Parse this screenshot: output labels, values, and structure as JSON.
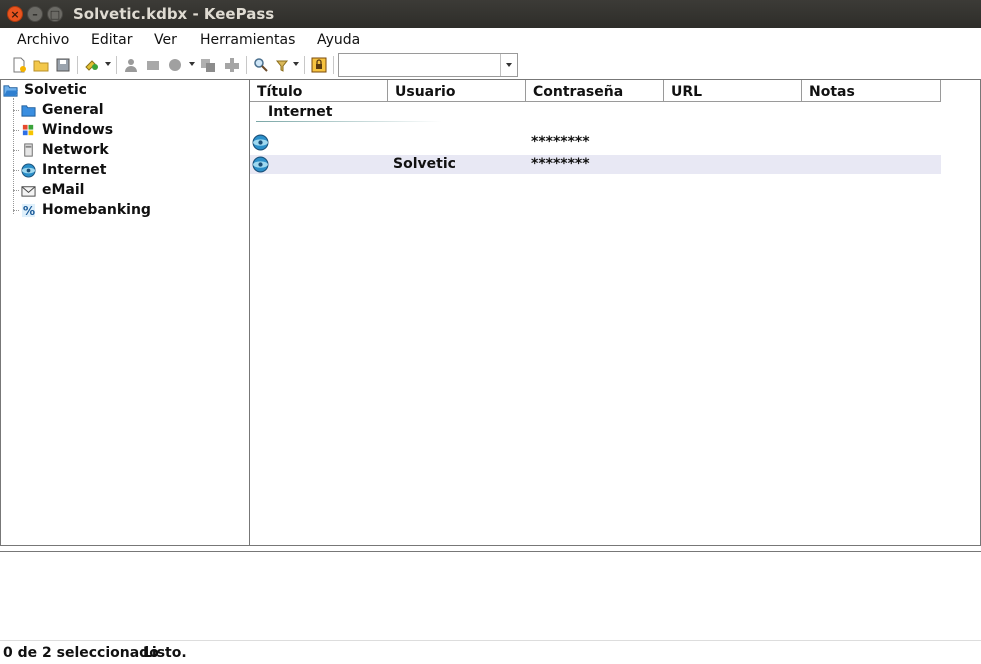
{
  "window": {
    "title": "Solvetic.kdbx - KeePass"
  },
  "menu": [
    "Archivo",
    "Editar",
    "Ver",
    "Herramientas",
    "Ayuda"
  ],
  "toolbar": {
    "search_value": ""
  },
  "tree": {
    "root": "Solvetic",
    "groups": [
      "General",
      "Windows",
      "Network",
      "Internet",
      "eMail",
      "Homebanking"
    ]
  },
  "list": {
    "columns": [
      "Título",
      "Usuario",
      "Contraseña",
      "URL",
      "Notas"
    ],
    "group_header": "Internet",
    "entries": [
      {
        "title": "",
        "user": "",
        "password": "********",
        "url": "",
        "notes": ""
      },
      {
        "title": "",
        "user": "Solvetic",
        "password": "********",
        "url": "",
        "notes": ""
      }
    ]
  },
  "status": {
    "selection": "0 de 2 seleccionado",
    "state": "Listo."
  },
  "colors": {
    "titlebar": "#3c3b37",
    "close_button": "#e9541f",
    "selected_row": "#e8e8f4"
  }
}
